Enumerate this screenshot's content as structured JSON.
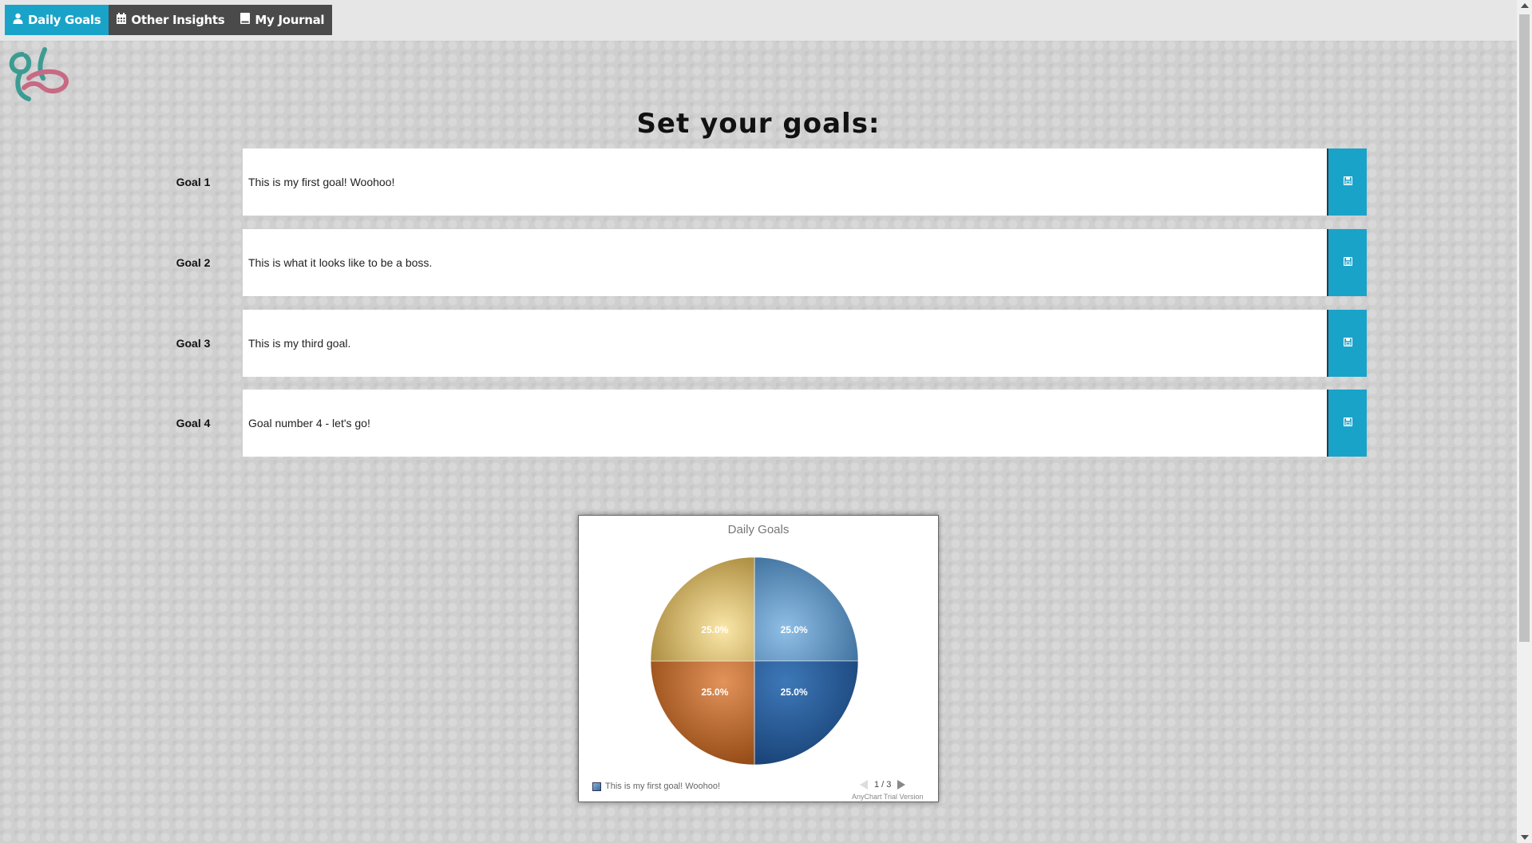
{
  "nav": {
    "items": [
      {
        "label": "Daily Goals",
        "icon": "user-icon",
        "active": true
      },
      {
        "label": "Other Insights",
        "icon": "calendar-icon",
        "active": false
      },
      {
        "label": "My Journal",
        "icon": "book-icon",
        "active": false
      }
    ]
  },
  "page": {
    "title": "Set your goals:"
  },
  "goals": [
    {
      "label": "Goal 1",
      "value": "This is my first goal! Woohoo!"
    },
    {
      "label": "Goal 2",
      "value": "This is what it looks like to be a boss."
    },
    {
      "label": "Goal 3",
      "value": "This is my third goal."
    },
    {
      "label": "Goal 4",
      "value": "Goal number 4 - let's go!"
    }
  ],
  "colors": {
    "accent": "#1aa3c9",
    "nav_bg": "#4a4a4a"
  },
  "chart_data": {
    "type": "pie",
    "title": "Daily Goals",
    "categories": [
      "This is my first goal! Woohoo!",
      "This is what it looks like to be a boss.",
      "This is my third goal.",
      "Goal number 4 - let's go!"
    ],
    "values": [
      25.0,
      25.0,
      25.0,
      25.0
    ],
    "labels": [
      "25.0%",
      "25.0%",
      "25.0%",
      "25.0%"
    ],
    "colors": [
      "#5b8fbe",
      "#1f5b97",
      "#b86628",
      "#d8c277"
    ],
    "legend": {
      "visible_entry": "This is my first goal! Woohoo!",
      "page": "1 / 3",
      "placement": "bottom-left"
    },
    "watermark": "AnyChart Trial Version"
  }
}
